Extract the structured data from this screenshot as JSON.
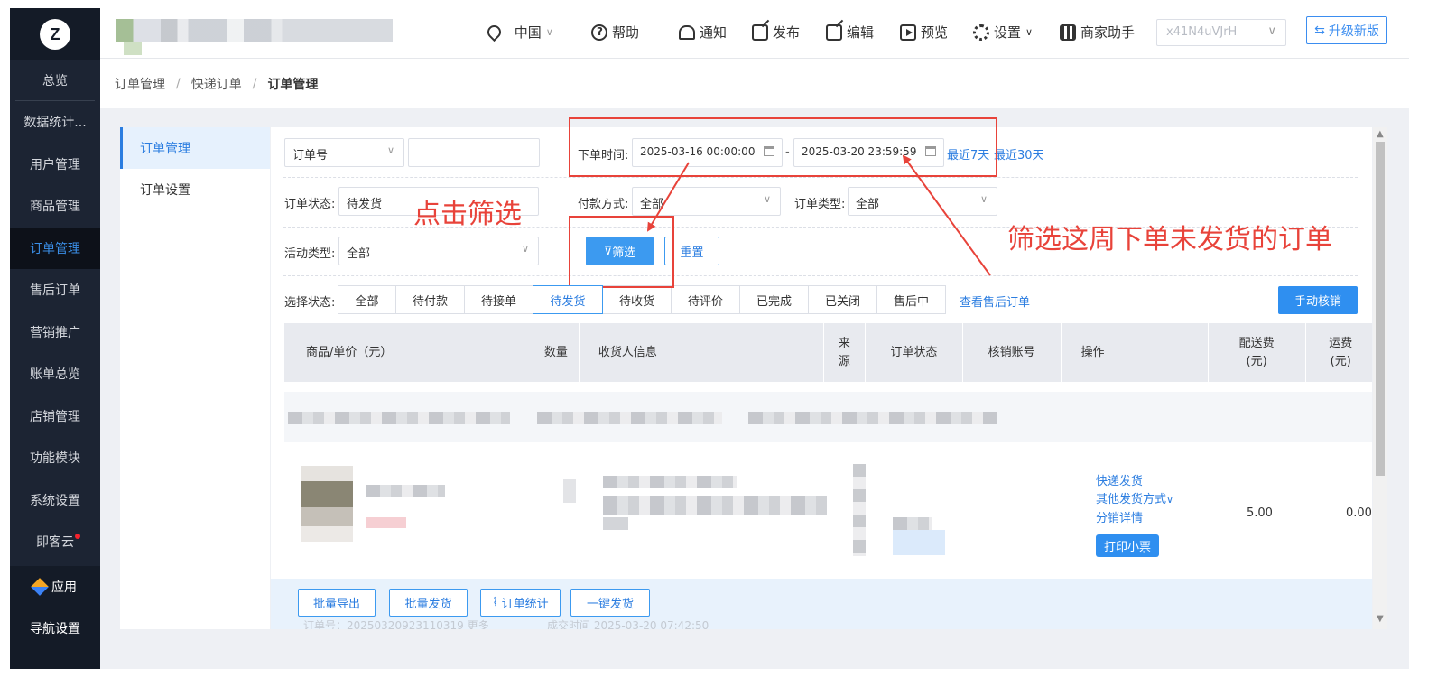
{
  "sidebar": {
    "logo": "Z",
    "items": [
      {
        "label": "总览"
      },
      {
        "label": "数据统计..."
      },
      {
        "label": "用户管理"
      },
      {
        "label": "商品管理"
      },
      {
        "label": "订单管理"
      },
      {
        "label": "售后订单"
      },
      {
        "label": "营销推广"
      },
      {
        "label": "账单总览"
      },
      {
        "label": "店铺管理"
      },
      {
        "label": "功能模块"
      },
      {
        "label": "系统设置"
      },
      {
        "label": "即客云"
      }
    ],
    "active_index": 4,
    "apps_label": "应用",
    "nav_settings_label": "导航设置"
  },
  "topbar": {
    "region": "中国",
    "help": "帮助",
    "notify": "通知",
    "publish": "发布",
    "edit": "编辑",
    "preview": "预览",
    "settings": "设置",
    "merchant_helper": "商家助手",
    "account_placeholder": "x41N4uVJrH",
    "upgrade": "升级新版"
  },
  "breadcrumb": [
    "订单管理",
    "快递订单",
    "订单管理"
  ],
  "submenu": [
    "订单管理",
    "订单设置"
  ],
  "filters": {
    "search_type": "订单号",
    "search_value": "",
    "order_time_label": "下单时间:",
    "start_time": "2025-03-16 00:00:00",
    "end_time": "2025-03-20 23:59:59",
    "range_sep": "-",
    "last7": "最近7天",
    "last30": "最近30天",
    "order_status_label": "订单状态:",
    "order_status": "待发货",
    "pay_method_label": "付款方式:",
    "pay_method": "全部",
    "order_type_label": "订单类型:",
    "order_type": "全部",
    "activity_type_label": "活动类型:",
    "activity_type": "全部",
    "filter_btn": "筛选",
    "reset_btn": "重置"
  },
  "status_tabs": {
    "label": "选择状态:",
    "tabs": [
      "全部",
      "待付款",
      "待接单",
      "待发货",
      "待收货",
      "待评价",
      "已完成",
      "已关闭",
      "售后中"
    ],
    "active_index": 3,
    "after_sale_link": "查看售后订单",
    "manual_verify": "手动核销"
  },
  "table": {
    "headers": [
      "商品/单价（元）",
      "数量",
      "收货人信息",
      "来\n源",
      "订单状态",
      "核销账号",
      "操作",
      "配送费\n(元)",
      "运费\n(元)"
    ],
    "row": {
      "ops": [
        "快递发货",
        "其他发货方式",
        "分销详情"
      ],
      "print_btn": "打印小票",
      "delivery_fee": "5.00",
      "shipping_fee": "0.00"
    }
  },
  "bottom_bar": {
    "buttons": [
      "批量导出",
      "批量发货",
      "订单统计",
      "一键发货"
    ],
    "faint_left": "订单号：20250320923110319 更多",
    "faint_mid": "成交时间 2025-03-20 07:42:50"
  },
  "annotations": {
    "click_filter": "点击筛选",
    "filter_note": "筛选这周下单未发货的订单"
  },
  "colors": {
    "sidebar_bg": "#1c2433",
    "accent": "#2b7de0",
    "annotation": "#e8433a"
  }
}
